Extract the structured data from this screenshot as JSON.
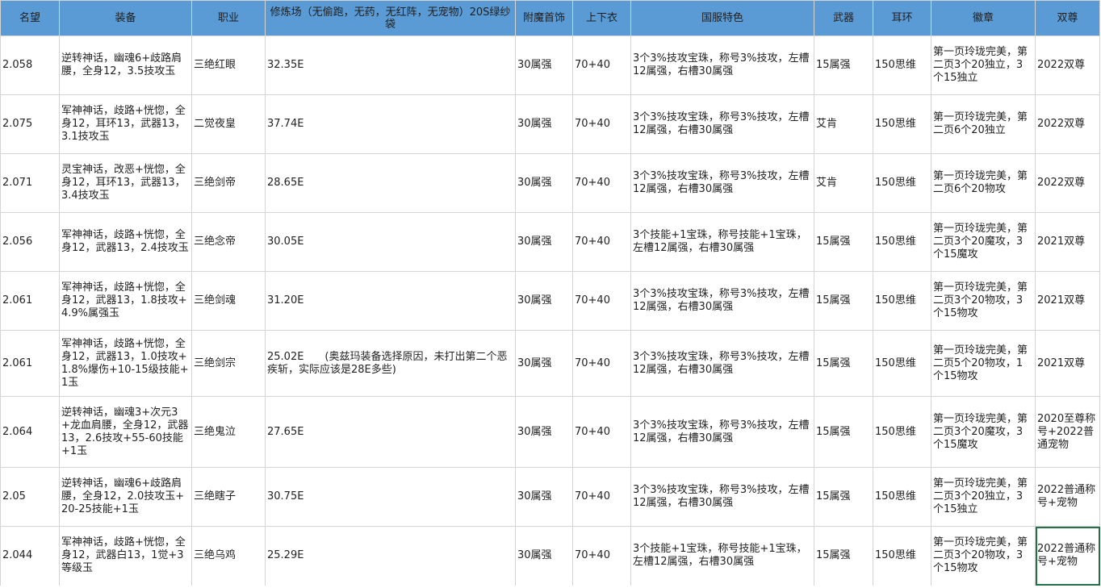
{
  "table": {
    "headers": [
      "名望",
      "装备",
      "职业",
      "修炼场（无偷跑，无药，无红阵，无宠物）20S绿纱袋",
      "附魔首饰",
      "上下衣",
      "国服特色",
      "武器",
      "耳环",
      "徽章",
      "双尊"
    ],
    "rows": [
      [
        "2.058",
        "逆转神话，幽魂6+歧路肩腰，全身12，3.5技攻玉",
        "三绝红眼",
        "32.35E",
        "30属强",
        "70+40",
        "3个3%技攻宝珠，称号3%技攻，左槽12属强，右槽30属强",
        "15属强",
        "150思维",
        "第一页玲珑完美，第二页3个20独立，3个15独立",
        "2022双尊"
      ],
      [
        "2.075",
        "军神神话，歧路+恍惚，全身12，耳环13，武器13，3.1技攻玉",
        "二觉夜皇",
        "37.74E",
        "30属强",
        "70+40",
        "3个3%技攻宝珠，称号3%技攻，左槽12属强，右槽30属强",
        "艾肯",
        "150思维",
        "第一页玲珑完美，第二页6个20独立",
        "2022双尊"
      ],
      [
        "2.071",
        "灵宝神话，改恶+恍惚，全身12，耳环13，武器13，3.4技攻玉",
        "三绝剑帝",
        "28.65E",
        "30属强",
        "70+40",
        "3个3%技攻宝珠，称号3%技攻，左槽12属强，右槽30属强",
        "艾肯",
        "150思维",
        "第一页玲珑完美，第二页6个20物攻",
        "2022双尊"
      ],
      [
        "2.056",
        "军神神话，歧路+恍惚，全身12，武器13，2.4技攻玉",
        "三绝念帝",
        "30.05E",
        "30属强",
        "70+40",
        "3个技能+1宝珠，称号技能+1宝珠，左槽12属强，右槽30属强",
        "15属强",
        "150思维",
        "第一页玲珑完美，第二页3个20魔攻，3个15魔攻",
        "2021双尊"
      ],
      [
        "2.061",
        "军神神话，歧路+恍惚，全身12，武器13，1.8技攻+4.9%属强玉",
        "三绝剑魂",
        "31.20E",
        "30属强",
        "70+40",
        "3个3%技攻宝珠，称号3%技攻，左槽12属强，右槽30属强",
        "15属强",
        "150思维",
        "第一页玲珑完美，第二页3个20物攻，3个15物攻",
        "2021双尊"
      ],
      [
        "2.061",
        "军神神话，歧路+恍惚，全身12，武器13，1.0技攻+1.8%爆伤+10-15级技能+1玉",
        "三绝剑宗",
        "25.02E　　(奥兹玛装备选择原因，未打出第二个恶疾斩，实际应该是28E多些)",
        "30属强",
        "70+40",
        "3个3%技攻宝珠，称号3%技攻，左槽12属强，右槽30属强",
        "15属强",
        "150思维",
        "第一页玲珑完美，第二页5个20物攻，1个15物攻",
        "2021双尊"
      ],
      [
        "2.064",
        "逆转神话，幽魂3+次元3+龙血肩腰，全身12，武器13，2.6技攻+55-60技能+1玉",
        "三绝鬼泣",
        "27.65E",
        "30属强",
        "70+40",
        "3个3%技攻宝珠，称号3%技攻，左槽12属强，右槽30属强",
        "15属强",
        "150思维",
        "第一页玲珑完美，第二页3个20魔攻，3个15魔攻",
        "2020至尊称号+2022普通宠物"
      ],
      [
        "2.05",
        "逆转神话，幽魂6+歧路肩腰，全身12，2.0技攻玉+20-25技能+1玉",
        "三绝瞎子",
        "30.75E",
        "30属强",
        "70+40",
        "3个3%技攻宝珠，称号3%技攻，左槽12属强，右槽30属强",
        "15属强",
        "150思维",
        "第一页玲珑完美，第二页3个20独立，3个15独立",
        "2022普通称号+宠物"
      ],
      [
        "2.044",
        "军神神话，歧路+恍惚，全身12，武器白13，1觉+3等级玉",
        "三绝乌鸡",
        "25.29E",
        "30属强",
        "70+40",
        "3个技能+1宝珠，称号技能+1宝珠，左槽12属强，右槽30属强",
        "15属强",
        "150思维",
        "第一页玲珑完美，第二页3个20物攻，3个15物攻",
        "2022普通称号+宠物"
      ]
    ]
  }
}
